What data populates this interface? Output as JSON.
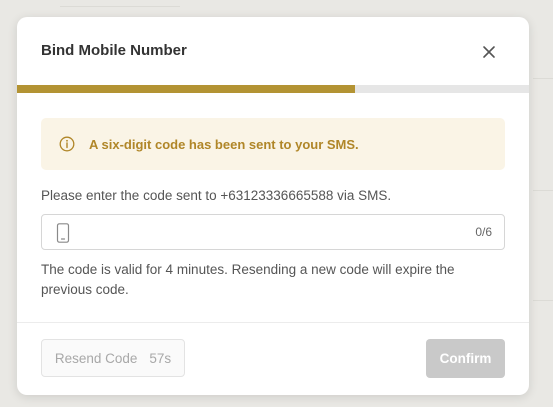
{
  "dialog": {
    "title": "Bind Mobile Number",
    "close_icon": "close-icon"
  },
  "progress": {
    "fraction": 0.66,
    "fill_color": "#b39333",
    "track_color": "#e6e6e6"
  },
  "alert": {
    "icon": "info-circle-icon",
    "message": "A six-digit code has been sent to your SMS.",
    "text_color": "#b08628",
    "background_color": "#faf4e6"
  },
  "form": {
    "prompt": "Please enter the code sent to +63123336665588 via SMS.",
    "code_field": {
      "icon": "mobile-phone-icon",
      "value": "",
      "placeholder": "",
      "char_count": "0/6"
    },
    "validity_note": "The code is valid for 4 minutes. Resending a new code will expire the previous code."
  },
  "footer": {
    "resend_label": "Resend Code",
    "resend_countdown": "57s",
    "confirm_label": "Confirm"
  }
}
